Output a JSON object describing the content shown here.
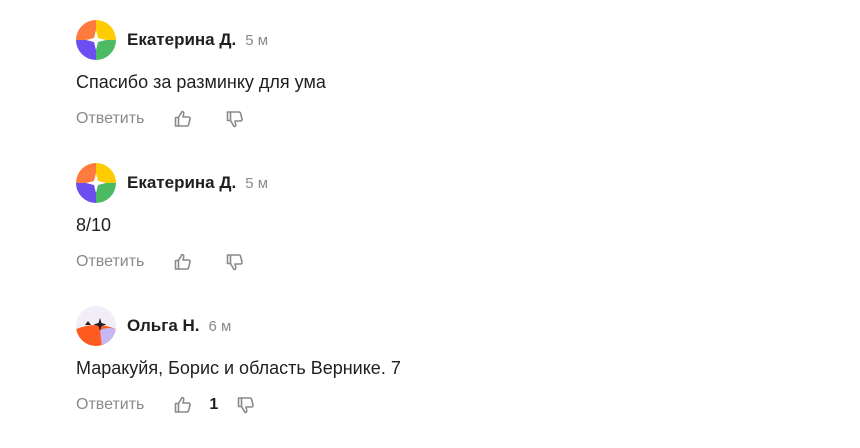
{
  "comments": [
    {
      "author": "Екатерина Д.",
      "time": "5 м",
      "text": "Спасибо за разминку для ума",
      "reply_label": "Ответить",
      "like_count": ""
    },
    {
      "author": "Екатерина Д.",
      "time": "5 м",
      "text": "8/10",
      "reply_label": "Ответить",
      "like_count": ""
    },
    {
      "author": "Ольга Н.",
      "time": "6 м",
      "text": "Маракуйя, Борис и область Вернике. 7",
      "reply_label": "Ответить",
      "like_count": "1"
    }
  ],
  "icons": {
    "like": "thumbs-up-icon",
    "dislike": "thumbs-down-icon"
  },
  "colors": {
    "text": "#1f1f1f",
    "muted": "#8a8a8a",
    "avatar_orange": "#ff7a3d",
    "avatar_yellow": "#ffcc00",
    "avatar_purple": "#6b4df0",
    "avatar_green": "#4cb963"
  }
}
